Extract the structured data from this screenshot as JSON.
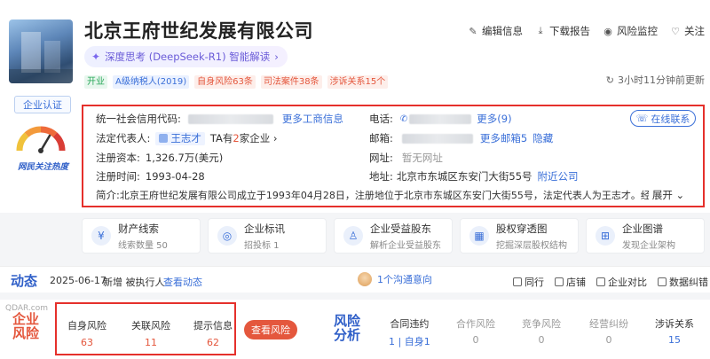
{
  "company": {
    "name": "北京王府世纪发展有限公司",
    "ai_chip": "深度思考 (DeepSeek-R1) 智能解读",
    "tags": [
      {
        "label": "开业",
        "tone": "green"
      },
      {
        "label": "A级纳税人(2019)",
        "tone": "blue"
      },
      {
        "label": "自身风险63条",
        "tone": "red"
      },
      {
        "label": "司法案件38条",
        "tone": "red"
      },
      {
        "label": "涉诉关系15个",
        "tone": "red"
      }
    ],
    "update_text": "3小时11分钟前更新",
    "auth_label": "企业认证",
    "gauge_label": "网民关注热度"
  },
  "actions": [
    {
      "label": "编辑信息",
      "icon": "edit-icon",
      "glyph": "✎"
    },
    {
      "label": "下载报告",
      "icon": "download-icon",
      "glyph": "⤓"
    },
    {
      "label": "风险监控",
      "icon": "eye-icon",
      "glyph": "◉"
    },
    {
      "label": "关注",
      "icon": "heart-icon",
      "glyph": "♡"
    }
  ],
  "info": {
    "credit_code_label": "统一社会信用代码:",
    "more_business": "更多工商信息",
    "phone_label": "电话:",
    "phone_more": "更多(9)",
    "online_contact": "在线联系",
    "legal_rep_label": "法定代表人:",
    "legal_rep_name": "王志才",
    "legal_rep_extra_prefix": "TA有",
    "legal_rep_extra_num": "2",
    "legal_rep_extra_suffix": "家企业",
    "email_label": "邮箱:",
    "email_more": "更多邮箱5",
    "email_hide": "隐藏",
    "capital_label": "注册资本:",
    "capital_value": "1,326.7万(美元)",
    "website_label": "网址:",
    "website_value": "暂无网址",
    "reg_time_label": "注册时间:",
    "reg_time_value": "1993-04-28",
    "address_label": "地址:",
    "address_value": "北京市东城区东安门大街55号",
    "address_link": "附近公司",
    "intro_label": "简介:",
    "intro_value": "北京王府世纪发展有限公司成立于1993年04月28日，注册地位于北京市东城区东安门大街55号，法定代表人为王志才。经营范围包括出租、...",
    "expand": "展开"
  },
  "cards": [
    {
      "title": "财产线索",
      "sub": "线索数量 50",
      "icon": "property-icon"
    },
    {
      "title": "企业标讯",
      "sub": "招投标 1",
      "icon": "bid-icon"
    },
    {
      "title": "企业受益股东",
      "sub": "解析企业受益股东",
      "icon": "shareholder-icon"
    },
    {
      "title": "股权穿透图",
      "sub": "挖掘深层股权结构",
      "icon": "equity-icon"
    },
    {
      "title": "企业图谱",
      "sub": "发现企业架构",
      "icon": "graph-icon"
    }
  ],
  "dynamics": {
    "title": "动态",
    "date": "2025-06-17",
    "text": "新增 被执行人",
    "link": "查看动态",
    "center": "1个沟通意向",
    "right": [
      "同行",
      "店铺",
      "企业对比",
      "数据纠错"
    ]
  },
  "risk": {
    "title": "企业风险",
    "watermark": "QDAR.com",
    "items": [
      {
        "label": "自身风险",
        "value": "63"
      },
      {
        "label": "关联风险",
        "value": "11"
      },
      {
        "label": "提示信息",
        "value": "62"
      }
    ],
    "view_button": "查看风险"
  },
  "analysis": {
    "title": "风险分析",
    "items": [
      {
        "label": "合同违约",
        "value": "1 | 自身1",
        "active": true
      },
      {
        "label": "合作风险",
        "value": "0",
        "active": false
      },
      {
        "label": "竞争风险",
        "value": "0",
        "active": false
      },
      {
        "label": "经营纠纷",
        "value": "0",
        "active": false
      },
      {
        "label": "涉诉关系",
        "value": "15",
        "active": true
      }
    ]
  }
}
